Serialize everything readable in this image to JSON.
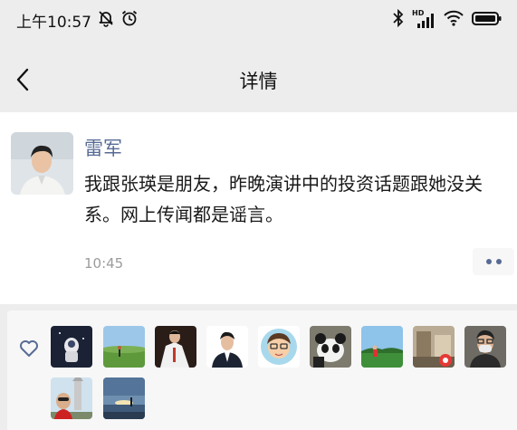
{
  "status_bar": {
    "time": "上午10:57",
    "network_label": "HD"
  },
  "nav": {
    "title": "详情"
  },
  "post": {
    "author": "雷军",
    "text": "我跟张瑛是朋友，昨晚演讲中的投资话题跟她没关系。网上传闻都是谣言。",
    "time": "10:45"
  },
  "likes": {
    "count_shown": 11
  }
}
